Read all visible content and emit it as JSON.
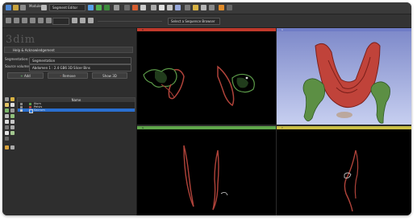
{
  "app": {
    "toolbar": {
      "modules_label": "Modules:",
      "module_selector": "Segment Editor",
      "layout_label": "Conventional widescreen",
      "search_placeholder": ""
    },
    "toolbar2": {
      "sequence_label": "",
      "center_combo": "Select a Sequence Browser"
    }
  },
  "left": {
    "logo": "3dim",
    "section_title": "Help & Acknowledgement",
    "segmentation_label": "Segmentation:",
    "segmentation_value": "Segmentation",
    "source_volume_label": "Source volume:",
    "source_volume_value": "Abdomen 1 : 2.4 GB6 3D Slicer Bins",
    "buttons": {
      "add": "Add",
      "remove": "Remove",
      "show3d": "Show 3D"
    },
    "table_header": "Name",
    "segments": [
      {
        "name": "Ilium",
        "color": "#5c9b49"
      },
      {
        "name": "Pelvis",
        "color": "#b0433a"
      },
      {
        "name": "Sacrum",
        "color": "#2f7de0"
      }
    ]
  },
  "views": {
    "red": {
      "color": "#c0392b"
    },
    "threeD": {
      "color": "#6f7cc6"
    },
    "green": {
      "color": "#5fa64b"
    },
    "yellow": {
      "color": "#cbbf45"
    }
  }
}
